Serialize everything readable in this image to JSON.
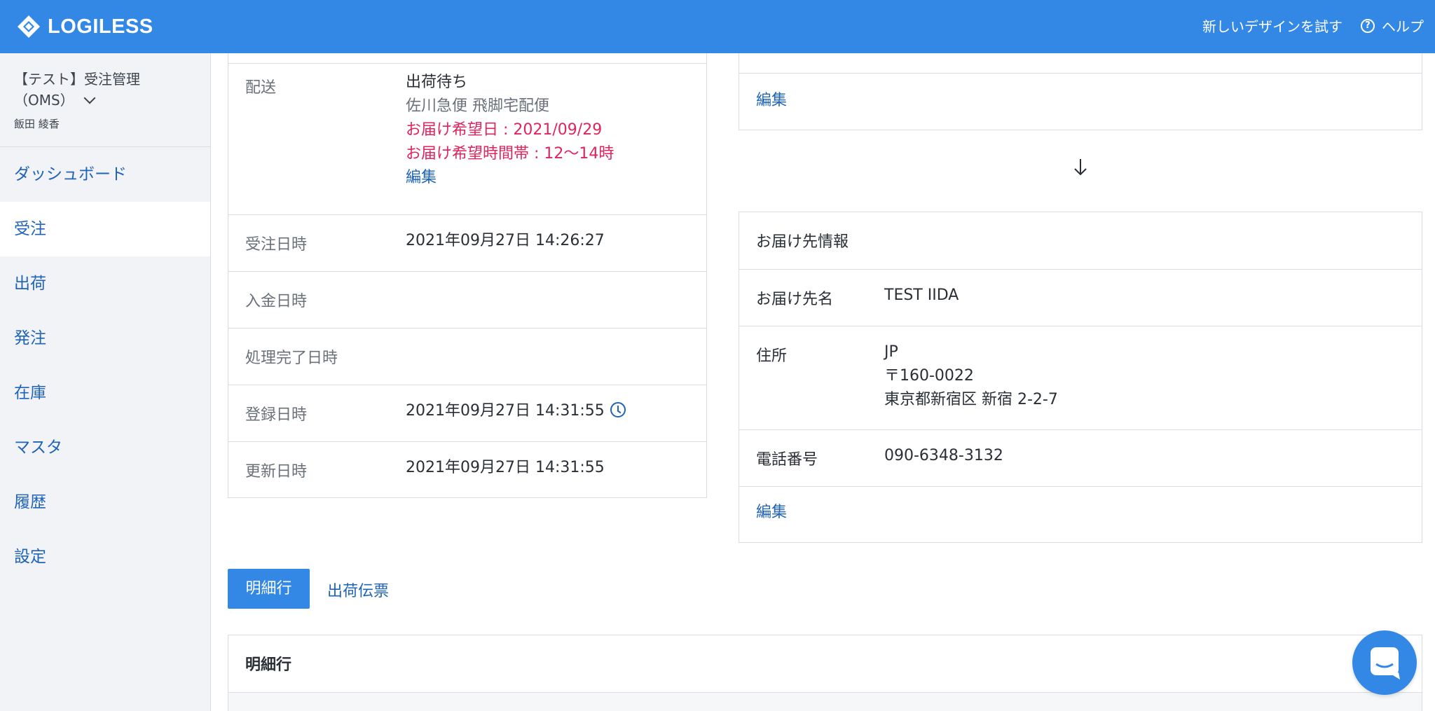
{
  "header": {
    "brand": "LOGILESS",
    "try_new_design": "新しいデザインを試す",
    "help": "ヘルプ",
    "help_icon_glyph": "?"
  },
  "sidebar": {
    "workspace_line1": "【テスト】受注管理",
    "workspace_line2": "（OMS）",
    "user": "飯田 綾香",
    "items": [
      {
        "label": "ダッシュボード"
      },
      {
        "label": "受注"
      },
      {
        "label": "出荷"
      },
      {
        "label": "発注"
      },
      {
        "label": "在庫"
      },
      {
        "label": "マスタ"
      },
      {
        "label": "履歴"
      },
      {
        "label": "設定"
      }
    ]
  },
  "order_detail": {
    "delivery": {
      "label": "配送",
      "status": "出荷待ち",
      "carrier": "佐川急便 飛脚宅配便",
      "desired_date": "お届け希望日 : 2021/09/29",
      "desired_time": "お届け希望時間帯 : 12〜14時",
      "edit": "編集"
    },
    "rows": [
      {
        "label": "受注日時",
        "value": "2021年09月27日 14:26:27"
      },
      {
        "label": "入金日時",
        "value": ""
      },
      {
        "label": "処理完了日時",
        "value": ""
      },
      {
        "label": "登録日時",
        "value": "2021年09月27日 14:31:55"
      },
      {
        "label": "更新日時",
        "value": "2021年09月27日 14:31:55"
      }
    ]
  },
  "top_right_card": {
    "edit": "編集"
  },
  "recipient": {
    "title": "お届け先情報",
    "name_label": "お届け先名",
    "name_value": "TEST IIDA",
    "address_label": "住所",
    "address_country": "JP",
    "address_zip": "〒160-0022",
    "address_line": "東京都新宿区 新宿 2-2-7",
    "phone_label": "電話番号",
    "phone_value": "090-6348-3132",
    "edit": "編集"
  },
  "tabs": {
    "active": "明細行",
    "other": "出荷伝票"
  },
  "line_items": {
    "title": "明細行"
  },
  "colors": {
    "brand_blue": "#3388e6",
    "link_blue": "#1f64b8",
    "warning_red": "#e0245e"
  }
}
